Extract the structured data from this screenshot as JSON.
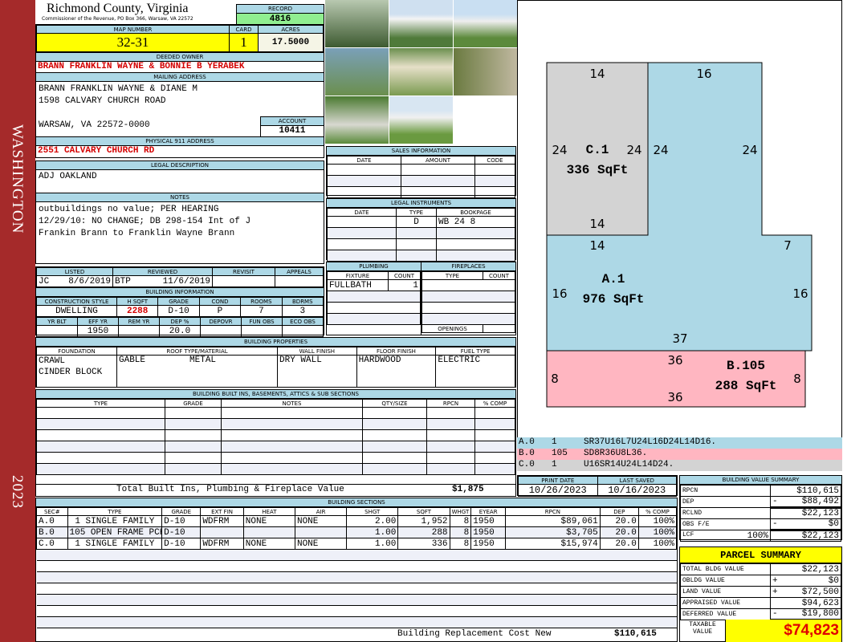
{
  "side": {
    "county": "WASHINGTON",
    "year": "2023"
  },
  "header": {
    "title": "Richmond County, Virginia",
    "subtitle": "Commissioner of the Revenue, PO Box 366, Warsaw, VA 22572",
    "record_label": "RECORD",
    "record": "4816"
  },
  "map": {
    "map_label": "MAP NUMBER",
    "map_number": "32-31",
    "card_label": "CARD",
    "card": "1",
    "acres_label": "ACRES",
    "acres": "17.5000"
  },
  "owner": {
    "label": "DEEDED OWNER",
    "value": "BRANN FRANKLIN WAYNE & BONNIE B YERABEK"
  },
  "mailing": {
    "label": "MAILING ADDRESS",
    "line1": "BRANN FRANKLIN WAYNE & DIANE M",
    "line2": "1598 CALVARY CHURCH ROAD",
    "line3": "WARSAW, VA 22572-0000",
    "account_label": "ACCOUNT",
    "account": "10411"
  },
  "physical": {
    "label": "PHYSICAL 911 ADDRESS",
    "value": "2551 CALVARY CHURCH RD"
  },
  "legal": {
    "label": "LEGAL DESCRIPTION",
    "value": "ADJ OAKLAND"
  },
  "notes": {
    "label": "NOTES",
    "line1": "outbuildings no value; PER HEARING",
    "line2": "12/29/10: NO CHANGE; DB 298-154 Int of J",
    "line3": "Frankin Brann to Franklin Wayne Brann"
  },
  "listed": {
    "labels": [
      "LISTED",
      "REVIEWED",
      "REVISIT",
      "APPEALS"
    ],
    "listed_by": "JC",
    "listed_date": "8/6/2019",
    "reviewed_by": "BTP",
    "reviewed_date": "11/6/2019"
  },
  "building_info": {
    "title": "BUILDING INFORMATION",
    "labels1": [
      "CONSTRUCTION STYLE",
      "H SQFT",
      "GRADE",
      "COND",
      "ROOMS",
      "BDRMS"
    ],
    "values1": [
      "DWELLING",
      "2288",
      "D-10",
      "P",
      "7",
      "3"
    ],
    "labels2": [
      "YR BLT",
      "EFF YR",
      "REM YR",
      "DEP %",
      "DEPOVR",
      "FUN OBS",
      "ECO OBS"
    ],
    "values2": [
      "",
      "1950",
      "",
      "20.0",
      "",
      "",
      ""
    ]
  },
  "building_props": {
    "title": "BUILDING PROPERTIES",
    "labels": [
      "FOUNDATION",
      "ROOF TYPE/MATERIAL",
      "WALL FINISH",
      "FLOOR FINISH",
      "FUEL TYPE"
    ],
    "foundation1": "CRAWL",
    "foundation2": "CINDER BLOCK",
    "roof_type": "GABLE",
    "roof_material": "METAL",
    "wall": "DRY WALL",
    "floor": "HARDWOOD",
    "fuel": "ELECTRIC"
  },
  "builtins": {
    "title": "BUILDING BUILT INS, BASEMENTS, ATTICS & SUB SECTIONS",
    "labels": [
      "TYPE",
      "GRADE",
      "NOTES",
      "QTY/SIZE",
      "RPCN",
      "% COMP"
    ],
    "total_label": "Total Built Ins, Plumbing & Fireplace Value",
    "total": "$1,875"
  },
  "sales": {
    "title": "SALES INFORMATION",
    "labels": [
      "DATE",
      "AMOUNT",
      "CODE"
    ]
  },
  "legal_instruments": {
    "title": "LEGAL INSTRUMENTS",
    "labels": [
      "DATE",
      "TYPE",
      "BOOKPAGE"
    ],
    "rows": [
      {
        "date": "",
        "type": "D",
        "bookpage": "WB 24 8"
      }
    ]
  },
  "plumbing": {
    "title": "PLUMBING",
    "labels": [
      "FIXTURE",
      "COUNT"
    ],
    "rows": [
      {
        "fixture": "FULLBATH",
        "count": "1"
      }
    ]
  },
  "fireplaces": {
    "title": "FIREPLACES",
    "labels": [
      "TYPE",
      "COUNT"
    ],
    "openings_label": "OPENINGS"
  },
  "sketch": {
    "areas": [
      {
        "label": "C.1",
        "sqft": "336 SqFt",
        "color": "#d3d3d3"
      },
      {
        "label": "A.1",
        "sqft": "976 SqFt",
        "color": "#add8e6"
      },
      {
        "label": "B.105",
        "sqft": "288 SqFt",
        "color": "#ffb6c1"
      }
    ],
    "dims": [
      "14",
      "16",
      "24",
      "24",
      "24",
      "24",
      "14",
      "14",
      "7",
      "16",
      "16",
      "37",
      "36",
      "36",
      "8",
      "8"
    ],
    "vectors": [
      {
        "sec": "A.0",
        "code": "1",
        "path": "SR37U16L7U24L16D24L14D16.",
        "color": "#add8e6"
      },
      {
        "sec": "B.0",
        "code": "105",
        "path": "SD8R36U8L36.",
        "color": "#ffb6c1"
      },
      {
        "sec": "C.0",
        "code": "1",
        "path": "U16SR14U24L14D24.",
        "color": "#d3d3d3"
      }
    ]
  },
  "dates": {
    "print_label": "PRINT DATE",
    "print": "10/26/2023",
    "saved_label": "LAST SAVED",
    "saved": "10/16/2023"
  },
  "sections": {
    "title": "BUILDING SECTIONS",
    "labels": [
      "SEC#",
      "TYPE",
      "GRADE",
      "EXT FIN",
      "HEAT",
      "AIR",
      "SHGT",
      "SQFT",
      "WHGT",
      "EYEAR",
      "RPCN",
      "DEP",
      "% COMP"
    ],
    "rows": [
      [
        "A.0",
        "1 SINGLE FAMILY",
        "D-10",
        "WDFRM",
        "NONE",
        "NONE",
        "2.00",
        "1,952",
        "8",
        "1950",
        "$89,061",
        "20.0",
        "100%"
      ],
      [
        "B.0",
        "105 OPEN FRAME PCH",
        "D-10",
        "",
        "",
        "",
        "1.00",
        "288",
        "8",
        "1950",
        "$3,705",
        "20.0",
        "100%"
      ],
      [
        "C.0",
        "1 SINGLE FAMILY",
        "D-10",
        "WDFRM",
        "NONE",
        "NONE",
        "1.00",
        "336",
        "8",
        "1950",
        "$15,974",
        "20.0",
        "100%"
      ]
    ],
    "total_label": "Building Replacement Cost New",
    "total": "$110,615"
  },
  "bvs": {
    "title": "BUILDING VALUE SUMMARY",
    "rows": [
      {
        "label": "RPCN",
        "sign": "",
        "value": "$110,615"
      },
      {
        "label": "DEP",
        "sign": "-",
        "value": "$88,492"
      },
      {
        "label": "RCLND",
        "sign": "",
        "value": "$22,123"
      },
      {
        "label": "OBS F/E",
        "sign": "-",
        "value": "$0"
      },
      {
        "label": "LCF",
        "pct": "100%",
        "sign": "",
        "value": "$22,123"
      }
    ]
  },
  "parcel": {
    "title": "PARCEL SUMMARY",
    "rows": [
      {
        "label": "TOTAL BLDG VALUE",
        "sign": "",
        "value": "$22,123"
      },
      {
        "label": "OBLDG VALUE",
        "sign": "+",
        "value": "$0"
      },
      {
        "label": "LAND VALUE",
        "sign": "+",
        "value": "$72,500"
      },
      {
        "label": "APPRAISED VALUE",
        "sign": "",
        "value": "$94,623"
      },
      {
        "label": "DEFERRED VALUE",
        "sign": "-",
        "value": "$19,800"
      }
    ],
    "taxable_label": "TAXABLE VALUE",
    "taxable": "$74,823"
  }
}
